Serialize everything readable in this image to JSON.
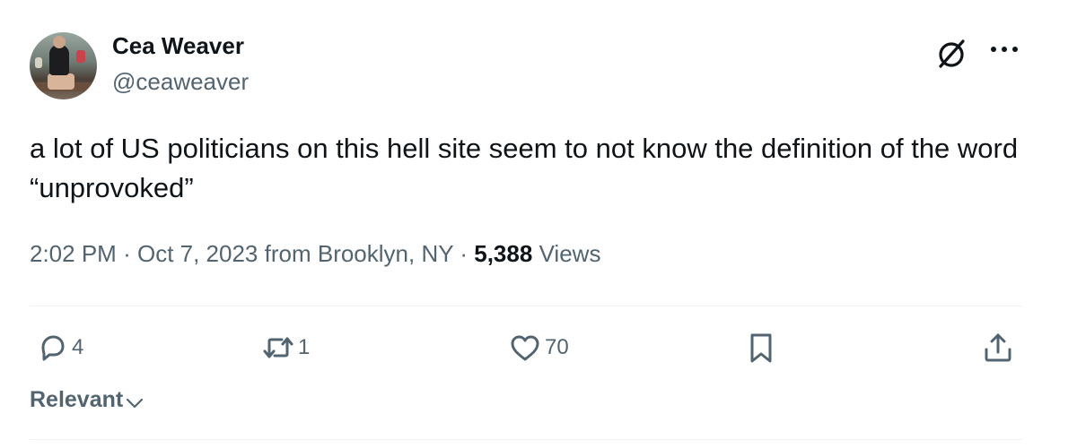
{
  "author": {
    "display_name": "Cea Weaver",
    "handle": "@ceaweaver"
  },
  "header_icons": [
    "grok-icon",
    "more-icon"
  ],
  "tweet": {
    "text": "a lot of US politicians on this hell site seem to not know the definition of the word “unprovoked”",
    "time": "2:02 PM",
    "date": "Oct 7, 2023",
    "location": "from Brooklyn, NY",
    "separator": "·",
    "views_count": "5,388",
    "views_label": "Views"
  },
  "actions": {
    "replies": "4",
    "reposts": "1",
    "likes": "70"
  },
  "sort": {
    "label": "Relevant"
  },
  "colors": {
    "text": "#0f1419",
    "secondary": "#536471",
    "divider": "#eff3f4"
  }
}
